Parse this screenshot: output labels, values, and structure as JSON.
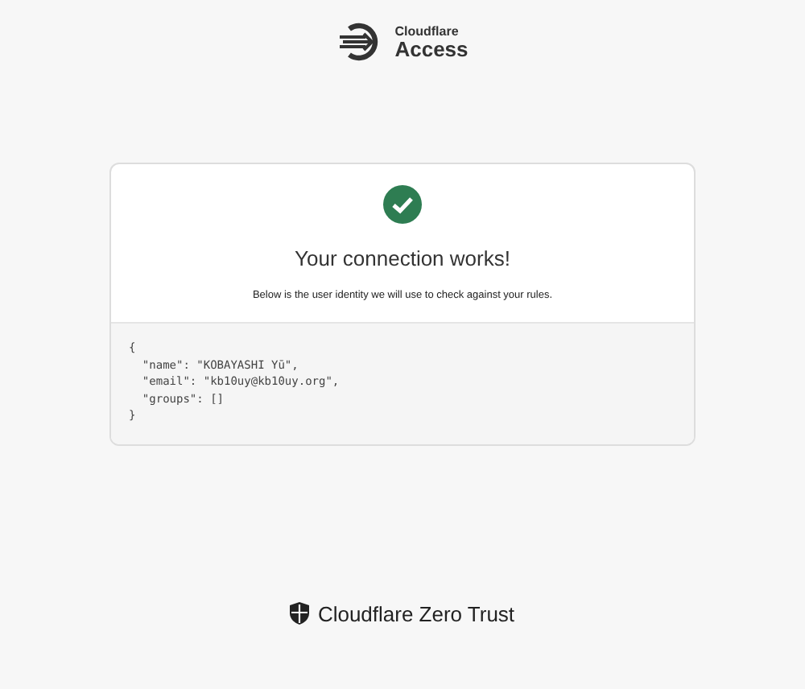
{
  "header": {
    "brand_small": "Cloudflare",
    "brand_large": "Access"
  },
  "card": {
    "success": true,
    "title": "Your connection works!",
    "description": "Below is the user identity we will use to check against your rules.",
    "code_lines": [
      "{",
      "  \"name\": \"KOBAYASHI Yū\",",
      "  \"email\": \"kb10uy@kb10uy.org\",",
      "  \"groups\": []",
      "}"
    ]
  },
  "footer": {
    "brand": "Cloudflare Zero Trust"
  }
}
